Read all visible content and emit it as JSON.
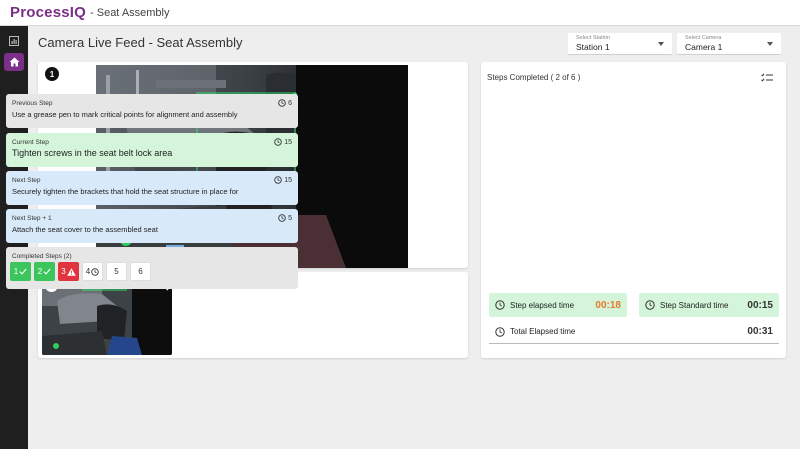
{
  "app": {
    "brand": "ProcessIQ",
    "subtitle": "- Seat Assembly"
  },
  "sidebar": {
    "items": [
      {
        "icon": "chart-icon"
      },
      {
        "icon": "home-icon",
        "active": true
      }
    ]
  },
  "page": {
    "title": "Camera Live Feed - Seat Assembly"
  },
  "selects": {
    "station": {
      "label": "Select Station",
      "value": "Station 1"
    },
    "camera": {
      "label": "Select Camera",
      "value": "Camera 1"
    }
  },
  "feed": {
    "number": "1",
    "thumb_number": "1"
  },
  "steps": {
    "header": "Steps Completed ( 2 of 6 )",
    "previous": {
      "title": "Previous Step",
      "desc": "Use a grease pen to mark critical points for alignment and assembly",
      "time": "6"
    },
    "current": {
      "title": "Current Step",
      "desc": "Tighten screws in the seat belt lock area",
      "time": "15"
    },
    "next": {
      "title": "Next Step",
      "desc": "Securely tighten the brackets that hold the seat structure in place for",
      "time": "15"
    },
    "next1": {
      "title": "Next Step + 1",
      "desc": "Attach the seat cover to the assembled seat",
      "time": "5"
    },
    "completed": {
      "title": "Completed Steps (2)",
      "chips": [
        {
          "label": "1",
          "status": "ok"
        },
        {
          "label": "2",
          "status": "ok"
        },
        {
          "label": "3",
          "status": "error"
        },
        {
          "label": "4",
          "status": "pending"
        },
        {
          "label": "5",
          "status": "todo"
        },
        {
          "label": "6",
          "status": "todo"
        }
      ]
    }
  },
  "timers": {
    "elapsed": {
      "label": "Step elapsed time",
      "value": "00:18"
    },
    "standard": {
      "label": "Step Standard time",
      "value": "00:15"
    },
    "total": {
      "label": "Total Elapsed time",
      "value": "00:31"
    }
  },
  "colors": {
    "brand": "#7b2f88",
    "ok": "#3cc55d",
    "error": "#e0353e",
    "elapsed": "#e8782a",
    "current_bg": "#d4f5d9",
    "next_bg": "#d8e9fa"
  }
}
